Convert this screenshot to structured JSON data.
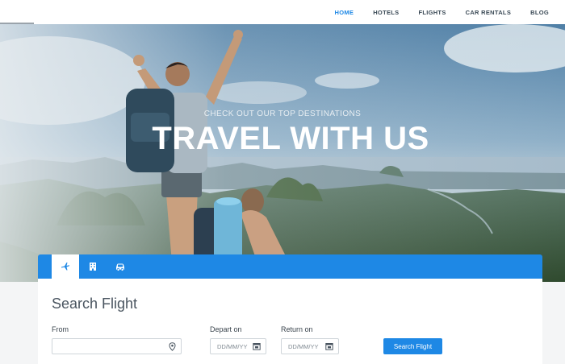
{
  "nav": {
    "items": [
      {
        "label": "HOME",
        "active": true
      },
      {
        "label": "HOTELS",
        "active": false
      },
      {
        "label": "FLIGHTS",
        "active": false
      },
      {
        "label": "CAR RENTALS",
        "active": false
      },
      {
        "label": "BLOG",
        "active": false
      }
    ]
  },
  "hero": {
    "kicker": "CHECK OUT OUR TOP DESTINATIONS",
    "headline": "TRAVEL WITH US"
  },
  "tabs": [
    {
      "icon": "plane-icon",
      "active": true
    },
    {
      "icon": "hotel-icon",
      "active": false
    },
    {
      "icon": "car-icon",
      "active": false
    }
  ],
  "form": {
    "title": "Search Flight",
    "from_label": "From",
    "from_placeholder": "",
    "depart_label": "Depart on",
    "depart_placeholder": "DD/MM/YY",
    "return_label": "Return on",
    "return_placeholder": "DD/MM/YY",
    "submit_label": "Search Flight"
  },
  "colors": {
    "accent": "#1e88e5",
    "nav_text": "#3b4a56"
  }
}
